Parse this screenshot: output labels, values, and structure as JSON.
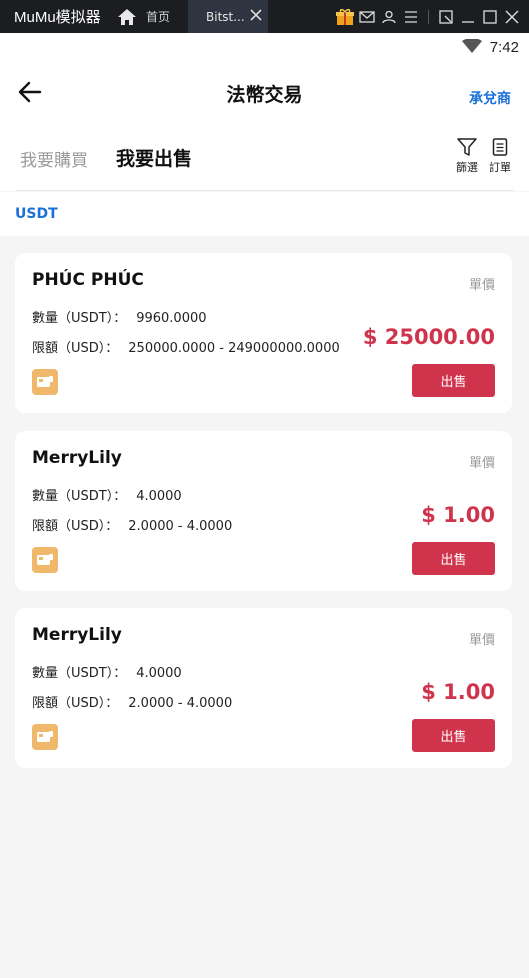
{
  "emulator": {
    "app_name": "MuMu模拟器",
    "tab_home": "首页",
    "tab_active": "Bitst...",
    "icons": [
      "home-icon",
      "close-icon",
      "gift-icon",
      "mail-icon",
      "user-icon",
      "menu-icon",
      "restore-icon",
      "minimize-icon",
      "maximize-icon",
      "close-window-icon"
    ]
  },
  "status_bar": {
    "time": "7:42",
    "icons": [
      "wifi-icon"
    ]
  },
  "header": {
    "title": "法幣交易",
    "merchant": "承兌商"
  },
  "tabs": {
    "buy": "我要購買",
    "sell": "我要出售",
    "filter": "篩選",
    "orders": "訂單"
  },
  "coin": "USDT",
  "colors": {
    "accent": "#1a6fd8",
    "price": "#d0344d",
    "sell_button": "#d0344d",
    "payment_badge": "#f0b86b"
  },
  "offers": [
    {
      "name": "PHÚC PHÚC",
      "unit_label": "單價",
      "qty_label": "數量（USDT）：",
      "qty": "9960.0000",
      "limit_label": "限額（USD）：",
      "limit": "250000.0000 - 249000000.0000",
      "price": "$ 25000.00",
      "sell": "出售"
    },
    {
      "name": "MerryLily",
      "unit_label": "單價",
      "qty_label": "數量（USDT）：",
      "qty": "4.0000",
      "limit_label": "限額（USD）：",
      "limit": "2.0000 - 4.0000",
      "price": "$ 1.00",
      "sell": "出售"
    },
    {
      "name": "MerryLily",
      "unit_label": "單價",
      "qty_label": "數量（USDT）：",
      "qty": "4.0000",
      "limit_label": "限額（USD）：",
      "limit": "2.0000 - 4.0000",
      "price": "$ 1.00",
      "sell": "出售"
    }
  ]
}
